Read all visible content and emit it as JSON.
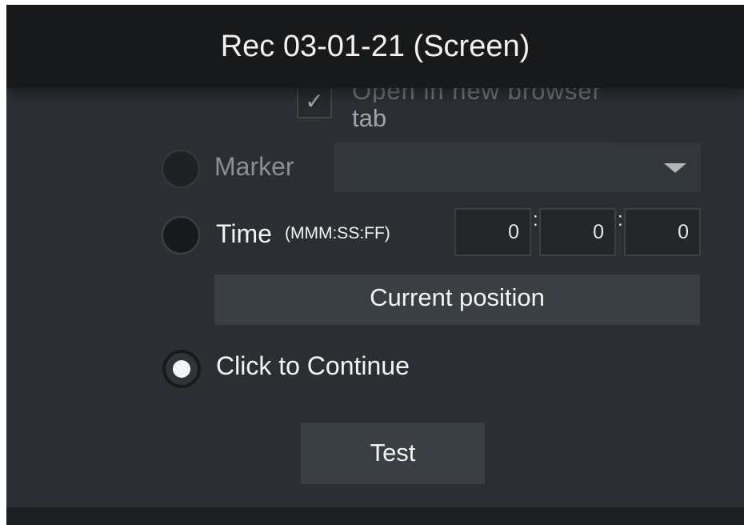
{
  "window": {
    "title": "Rec 03-01-21 (Screen)"
  },
  "options": {
    "checkbox_label_hidden": "Open in new browser",
    "checkbox_label": "tab",
    "marker_label": "Marker",
    "time_label": "Time",
    "time_format": "(MMM:SS:FF)",
    "time_values": [
      "0",
      "0",
      "0"
    ],
    "time_separator": ":",
    "current_position_label": "Current position",
    "click_to_continue_label": "Click to Continue",
    "test_label": "Test"
  },
  "icons": {
    "checkbox": "check-icon",
    "dropdown": "caret-down-icon"
  }
}
